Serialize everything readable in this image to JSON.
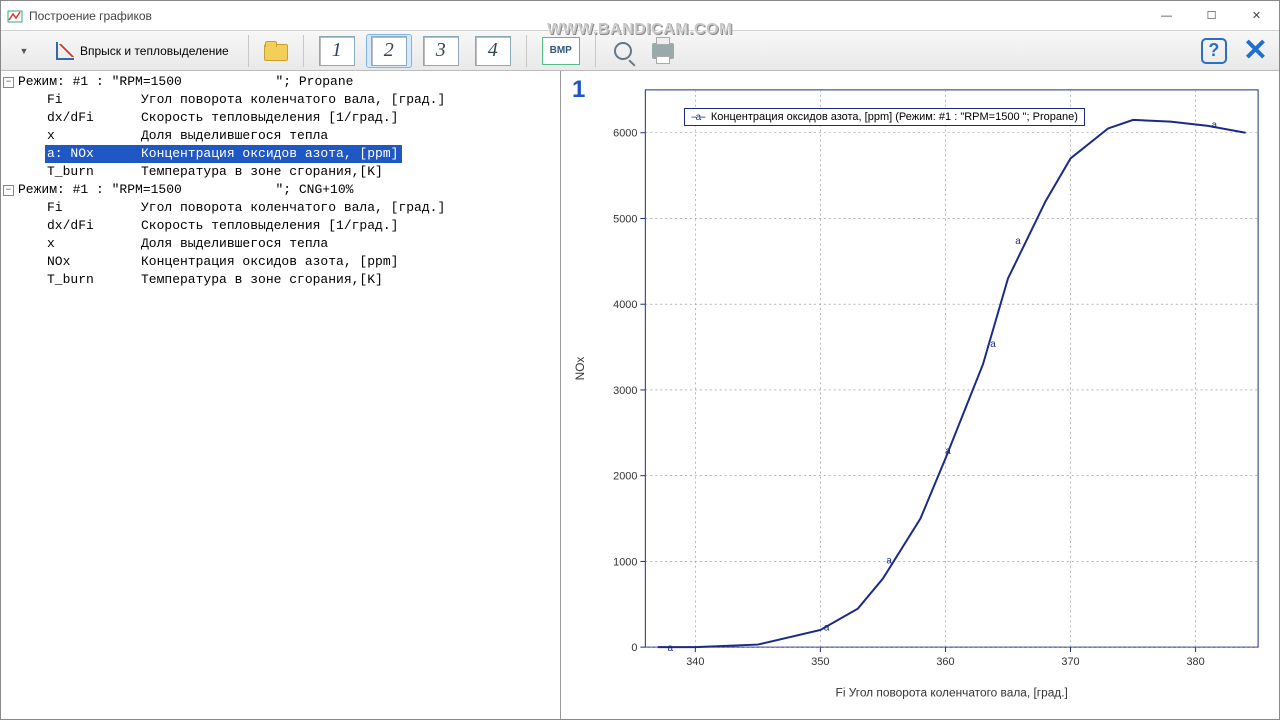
{
  "window": {
    "title": "Построение графиков",
    "watermark": "WWW.BANDICAM.COM"
  },
  "toolbar": {
    "mode_label": "Впрыск и тепловыделение",
    "num_buttons": [
      "1",
      "2",
      "3",
      "4"
    ],
    "bmp_label": "BMP"
  },
  "tree": {
    "groups": [
      {
        "header_prefix": "Режим: #1 : \"RPM=1500",
        "header_suffix": "\"; Propane",
        "items": [
          {
            "sym": "Fi",
            "desc": "Угол поворота коленчатого вала, [град.]",
            "sel": false
          },
          {
            "sym": "dx/dFi",
            "desc": "Скорость тепловыделения [1/град.]",
            "sel": false
          },
          {
            "sym": "x",
            "desc": "Доля выделившегося тепла",
            "sel": false
          },
          {
            "sym": "a: NOx",
            "desc": "Концентрация оксидов азота, [ppm]",
            "sel": true
          },
          {
            "sym": "T_burn",
            "desc": "Температура в зоне сгорания,[K]",
            "sel": false
          }
        ]
      },
      {
        "header_prefix": "Режим: #1 : \"RPM=1500",
        "header_suffix": "\"; CNG+10%",
        "items": [
          {
            "sym": "Fi",
            "desc": "Угол поворота коленчатого вала, [град.]",
            "sel": false
          },
          {
            "sym": "dx/dFi",
            "desc": "Скорость тепловыделения [1/град.]",
            "sel": false
          },
          {
            "sym": "x",
            "desc": "Доля выделившегося тепла",
            "sel": false
          },
          {
            "sym": "NOx",
            "desc": "Концентрация оксидов азота, [ppm]",
            "sel": false
          },
          {
            "sym": "T_burn",
            "desc": "Температура в зоне сгорания,[K]",
            "sel": false
          }
        ]
      }
    ]
  },
  "chart_data": {
    "panel_number": "1",
    "type": "line",
    "xlabel": "Fi        Угол поворота коленчатого вала, [град.]",
    "ylabel": "NOx",
    "xlim": [
      336,
      385
    ],
    "ylim": [
      0,
      6500
    ],
    "x_ticks": [
      340,
      350,
      360,
      370,
      380
    ],
    "y_ticks": [
      0,
      1000,
      2000,
      3000,
      4000,
      5000,
      6000
    ],
    "legend": "Концентрация оксидов азота, [ppm] (Режим: #1 : \"RPM=1500        \"; Propane)",
    "series": [
      {
        "name": "a",
        "color": "#1a2a88",
        "x": [
          337,
          340,
          345,
          350,
          353,
          355,
          358,
          360,
          363,
          365,
          368,
          370,
          373,
          375,
          378,
          381,
          384
        ],
        "values": [
          0,
          0,
          30,
          200,
          450,
          800,
          1500,
          2200,
          3300,
          4300,
          5200,
          5700,
          6050,
          6150,
          6130,
          6080,
          6000
        ],
        "markers_x": [
          338,
          350.5,
          355.5,
          360.2,
          363.8,
          365.8,
          381.5
        ],
        "markers_y": [
          0,
          240,
          1020,
          2300,
          3550,
          4750,
          6100
        ]
      }
    ]
  }
}
